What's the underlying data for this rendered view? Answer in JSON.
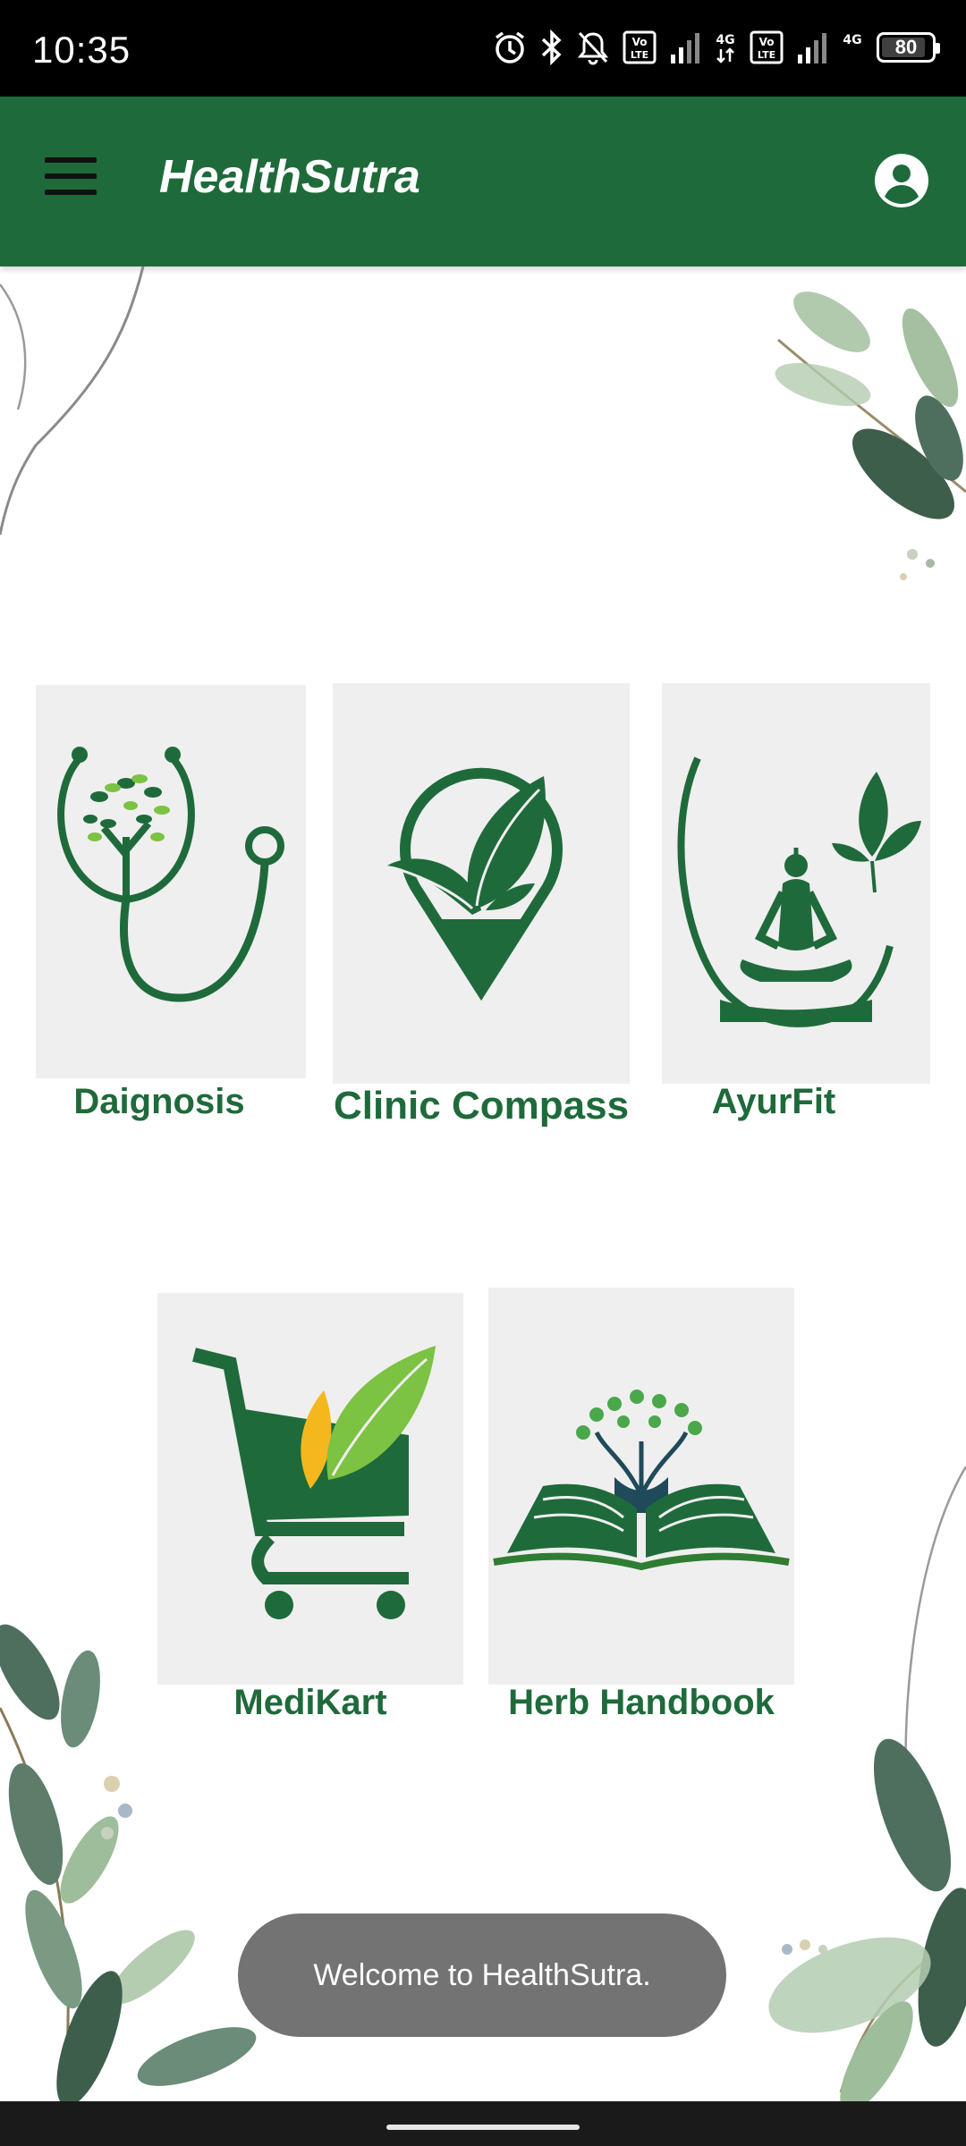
{
  "status_bar": {
    "time": "10:35",
    "battery": "80",
    "icons": [
      "alarm-icon",
      "bluetooth-icon",
      "bell-off-icon",
      "volte-icon",
      "signal-icon",
      "4g-icon",
      "volte-icon",
      "signal-icon",
      "4g-icon",
      "battery-icon"
    ]
  },
  "app_bar": {
    "title": "HealthSutra",
    "menu_icon": "hamburger-menu-icon",
    "profile_icon": "account-circle-icon"
  },
  "tiles": [
    {
      "label": "Daignosis",
      "icon": "stethoscope-tree-icon"
    },
    {
      "label": "Clinic Compass",
      "icon": "location-leaf-icon"
    },
    {
      "label": "AyurFit",
      "icon": "yoga-meditation-icon"
    },
    {
      "label": "MediKart",
      "icon": "cart-leaf-icon"
    },
    {
      "label": "Herb Handbook",
      "icon": "book-tree-icon"
    }
  ],
  "toast": {
    "message": "Welcome to HealthSutra."
  },
  "colors": {
    "primary": "#1f6a3b",
    "tile_background": "#efefef",
    "toast_background": "#737373",
    "status_bar": "#000000"
  }
}
